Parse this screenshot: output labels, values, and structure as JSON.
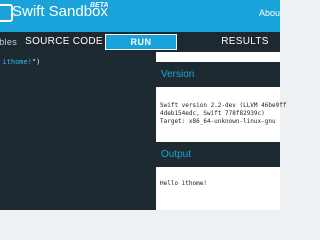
{
  "header": {
    "title": "Swift Sandbox",
    "badge": "BETA",
    "about_link": "Abou"
  },
  "tabs": {
    "examples": "ables",
    "source": "SOURCE CODE",
    "run": "RUN",
    "results": "RESULTS"
  },
  "editor": {
    "code_pre": "",
    "code_string": "o ithome!",
    "code_post": "\")"
  },
  "results": {
    "version_heading": "Version",
    "version_lines": "Swift version 2.2-dev (LLVM 46be9ff\n4deb154edc, Swift 778f82939c)\nTarget: x86_64-unknown-linux-gnu",
    "output_heading": "Output",
    "output_text": "Hello ithome!"
  },
  "colors": {
    "accent": "#1aa3db",
    "dark": "#1e2a32"
  }
}
